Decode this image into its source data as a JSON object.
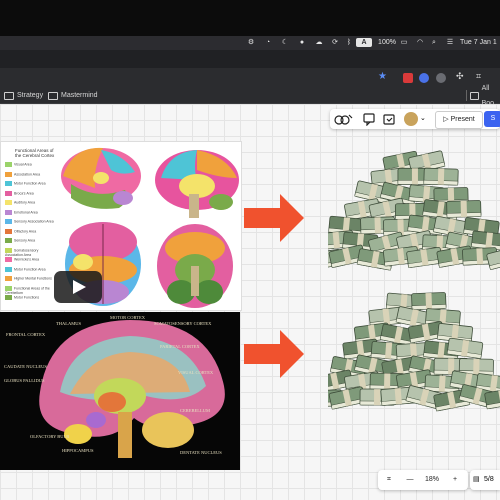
{
  "menubar": {
    "input_source": "A",
    "battery": "100%",
    "datetime": "Tue 7 Jan 1"
  },
  "bookmarks": {
    "items": [
      {
        "label": "Strategy"
      },
      {
        "label": "Mastermind"
      }
    ],
    "all_bookmarks": "All Boo"
  },
  "canvas_toolbar": {
    "present_label": "Present",
    "share_label": "S"
  },
  "zoom": {
    "minus": "—",
    "level": "18%",
    "plus": "+"
  },
  "pager": {
    "label": "5/8"
  },
  "brain_chart_top": {
    "legend_title": "Functional Areas of the Cerebral Cortex",
    "legend_items": [
      "Visual Area",
      "Association Area",
      "Motor Function Area",
      "Broca's Area",
      "Auditory Area",
      "Emotional Area",
      "Sensory Association Area",
      "Olfactory Area",
      "Sensory Area",
      "Somatosensory Association Area",
      "Wernicke's Area",
      "Motor Function Area",
      "Higher Mental Functions",
      "Functional Areas of the Cerebellum",
      "Motor Functions"
    ]
  },
  "brain_chart_bottom": {
    "labels": [
      "MOTOR CORTEX",
      "SOMATOSENSORY CORTEX",
      "THALAMUS",
      "FRONTAL CORTEX",
      "PARIETAL CORTEX",
      "CAUDATE NUCLEUS",
      "VISUAL CORTEX",
      "GLOBUS PALLIDUS",
      "CEREBELLUM",
      "DENTATE NUCLEUS",
      "OLFACTORY BULB",
      "HIPPOCAMPUS"
    ]
  },
  "colors": {
    "arrow": "#f0522e",
    "share_button": "#3b63f0"
  }
}
